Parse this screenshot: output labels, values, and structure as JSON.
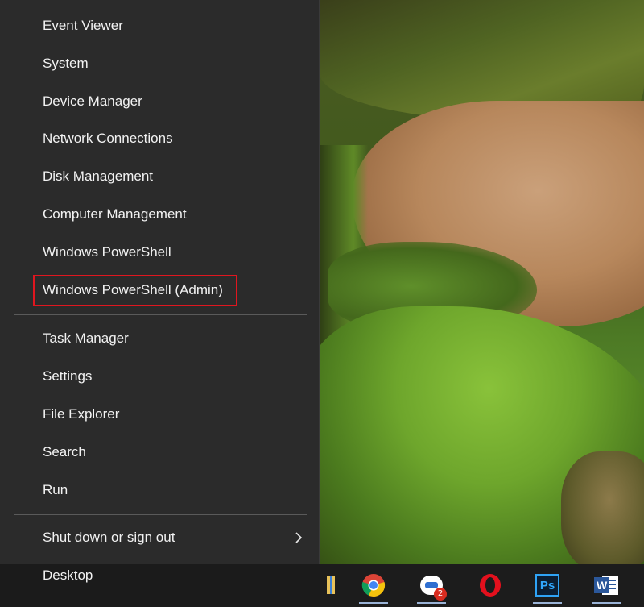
{
  "menu": {
    "items": [
      {
        "label": "Event Viewer"
      },
      {
        "label": "System"
      },
      {
        "label": "Device Manager"
      },
      {
        "label": "Network Connections"
      },
      {
        "label": "Disk Management"
      },
      {
        "label": "Computer Management"
      },
      {
        "label": "Windows PowerShell"
      },
      {
        "label": "Windows PowerShell (Admin)"
      },
      {
        "label": "Task Manager"
      },
      {
        "label": "Settings"
      },
      {
        "label": "File Explorer"
      },
      {
        "label": "Search"
      },
      {
        "label": "Run"
      },
      {
        "label": "Shut down or sign out"
      },
      {
        "label": "Desktop"
      }
    ],
    "highlighted_item": "Windows PowerShell (Admin)",
    "highlight_color": "#e0161f",
    "submenu_icon": "chevron-right-icon"
  },
  "taskbar": {
    "apps": [
      {
        "name": "file-explorer-icon"
      },
      {
        "name": "chrome-icon"
      },
      {
        "name": "zoho-icon",
        "badge": "2"
      },
      {
        "name": "opera-icon"
      },
      {
        "name": "photoshop-icon",
        "label": "Ps"
      },
      {
        "name": "word-icon",
        "label": "W"
      }
    ]
  },
  "colors": {
    "menu_bg": "#2b2b2b",
    "menu_text": "#f2f2f2",
    "separator": "#5a5a5a",
    "taskbar_bg": "#1c1c1c"
  }
}
